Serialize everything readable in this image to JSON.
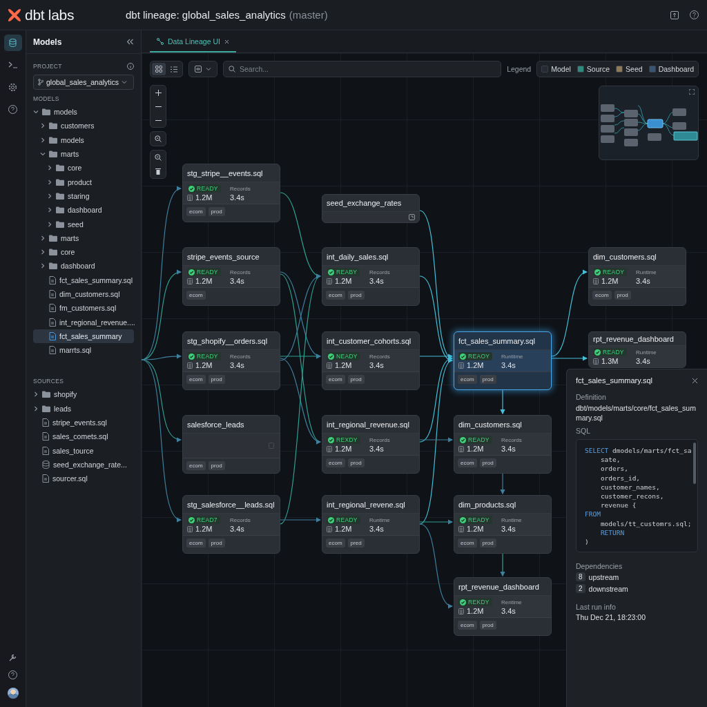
{
  "app": {
    "logo": "dbt labs",
    "title": "dbt lineage: global_sales_analytics",
    "branch": "(master)"
  },
  "sidebar": {
    "title": "Models",
    "project_label": "PROJECT",
    "project": "global_sales_analytics",
    "models_label": "MODELS",
    "sources_label": "SOURCES",
    "models": [
      {
        "label": "models",
        "kind": "folder",
        "expanded": true,
        "selected": false,
        "children": [
          {
            "label": "customers",
            "kind": "folder",
            "expanded": false,
            "selected": false
          },
          {
            "label": "models",
            "kind": "folder",
            "expanded": false,
            "selected": false
          },
          {
            "label": "marts",
            "kind": "folder",
            "expanded": true,
            "selected": false,
            "children": [
              {
                "label": "core",
                "kind": "folder",
                "expanded": false,
                "selected": false
              },
              {
                "label": "product",
                "kind": "folder",
                "expanded": false,
                "selected": false
              },
              {
                "label": "staring",
                "kind": "folder",
                "expanded": false,
                "selected": false
              },
              {
                "label": "dashboard",
                "kind": "folder",
                "expanded": false,
                "selected": false
              },
              {
                "label": "seed",
                "kind": "folder",
                "expanded": false,
                "selected": false
              }
            ]
          },
          {
            "label": "marts",
            "kind": "folder",
            "expanded": false,
            "selected": false
          },
          {
            "label": "core",
            "kind": "folder",
            "expanded": false,
            "selected": false
          },
          {
            "label": "dashboard",
            "kind": "folder",
            "expanded": false,
            "selected": false
          },
          {
            "label": "fct_sales_summary.sql",
            "kind": "file",
            "selected": false
          },
          {
            "label": "dim_customers.sql",
            "kind": "file",
            "selected": false
          },
          {
            "label": "fm_customers.sql",
            "kind": "file",
            "selected": false
          },
          {
            "label": "int_regional_revenue....",
            "kind": "file",
            "selected": false
          },
          {
            "label": "fct_sales_summary",
            "kind": "file",
            "selected": true
          },
          {
            "label": "marrts.sql",
            "kind": "file",
            "selected": false
          }
        ]
      }
    ],
    "sources": [
      {
        "label": "shopify",
        "kind": "folder",
        "expanded": false,
        "selected": false
      },
      {
        "label": "leads",
        "kind": "folder",
        "expanded": false,
        "selected": false
      },
      {
        "label": "stripe_events.sql",
        "kind": "file",
        "selected": false
      },
      {
        "label": "sales_comets.sql",
        "kind": "file",
        "selected": false
      },
      {
        "label": "sales_tource",
        "kind": "file",
        "selected": false
      },
      {
        "label": "seed_exchange_rate...",
        "kind": "seed",
        "selected": false
      },
      {
        "label": "sourcer.sql",
        "kind": "file",
        "selected": false
      }
    ]
  },
  "tabs": [
    {
      "label": "Data Lineage UI",
      "selected": true
    }
  ],
  "toolbar": {
    "views": [
      {
        "kind": "grid",
        "selected": true
      },
      {
        "kind": "list",
        "selected": false
      }
    ],
    "search_placeholder": "Search...",
    "legend_label": "Legend",
    "legend": [
      {
        "label": "Model",
        "color": "#262b33"
      },
      {
        "label": "Source",
        "color": "#2e8a7c"
      },
      {
        "label": "Seed",
        "color": "#8c7a58"
      },
      {
        "label": "Dashboard",
        "color": "#3a5573"
      }
    ]
  },
  "nodes": [
    {
      "title": "stg_stripe__events.sql",
      "kind": "metrics",
      "selected": false,
      "status": "READY",
      "metric": "Records",
      "count": "1.2M",
      "value": "3.4s",
      "tags": [
        "ecom",
        "prod"
      ]
    },
    {
      "title": "seed_exchange_rates",
      "kind": "collapsed",
      "selected": false
    },
    {
      "title": "stripe_events_source",
      "kind": "metrics",
      "selected": false,
      "status": "READY",
      "metric": "Records",
      "count": "1.2M",
      "value": "3.4s",
      "tags": [
        "ecom"
      ]
    },
    {
      "title": "int_daily_sales.sql",
      "kind": "metrics",
      "selected": false,
      "status": "REABY",
      "metric": "Records",
      "count": "1.2M",
      "value": "3.4s",
      "tags": [
        "ecom",
        "prod"
      ]
    },
    {
      "title": "dim_customers.sql",
      "kind": "metrics",
      "selected": false,
      "status": "REAOY",
      "metric": "Runtime",
      "count": "1.2M",
      "value": "3.4s",
      "tags": [
        "ecom",
        "prod"
      ]
    },
    {
      "title": "stg_shopify__orders.sql",
      "kind": "metrics",
      "selected": false,
      "status": "READY",
      "metric": "Records",
      "count": "1.2M",
      "value": "3.4s",
      "tags": [
        "ecom",
        "prod"
      ]
    },
    {
      "title": "int_customer_cohorts.sql",
      "kind": "metrics",
      "selected": false,
      "status": "NEADY",
      "metric": "Records",
      "count": "1.2M",
      "value": "3.4s",
      "tags": [
        "ecom",
        "prod"
      ]
    },
    {
      "title": "fct_sales_summary.sql",
      "kind": "metrics",
      "selected": true,
      "status": "REAOY",
      "metric": "Runtiime",
      "count": "1.2M",
      "value": "3.4s",
      "tags": [
        "ecom",
        "prod"
      ]
    },
    {
      "title": "rpt_revenue_dashboard",
      "kind": "metrics",
      "selected": false,
      "status": "READY",
      "metric": "Runtime",
      "count": "1.3M",
      "value": "3.4s"
    },
    {
      "title": "salesforce_leads",
      "kind": "blank",
      "selected": false,
      "tags": [
        "ecom",
        "prod"
      ]
    },
    {
      "title": "int_regional_revenue.sql",
      "kind": "metrics",
      "selected": false,
      "status": "REXDY",
      "metric": "Records",
      "count": "1.2M",
      "value": "3.4s",
      "tags": [
        "ecom",
        "prod"
      ]
    },
    {
      "title": "dim_customers.sql",
      "kind": "metrics",
      "selected": false,
      "status": "READY",
      "metric": "Records",
      "count": "1.2M",
      "value": "3.4s",
      "tags": [
        "ecom",
        "prod"
      ]
    },
    {
      "title": "stg_salesforce__leads.sql",
      "kind": "metrics",
      "selected": false,
      "status": "READ7",
      "metric": "Records",
      "count": "1.2M",
      "value": "3.4s",
      "tags": [
        "ecom",
        "prod"
      ]
    },
    {
      "title": "int_regional_revene.sql",
      "kind": "metrics",
      "selected": false,
      "status": "READY",
      "metric": "Runtime",
      "count": "1.2M",
      "value": "3.4s",
      "tags": [
        "ecom",
        "pred"
      ]
    },
    {
      "title": "dim_products.sql",
      "kind": "metrics",
      "selected": false,
      "status": "READY",
      "metric": "Runtime",
      "count": "1.2M",
      "value": "3.4s",
      "tags": [
        "ecom",
        "prod"
      ]
    },
    {
      "title": "rpt_revenue_dashboard",
      "kind": "metrics",
      "selected": false,
      "status": "REKDY",
      "metric": "Rentime",
      "count": "1.2M",
      "value": "3.4s",
      "tags": [
        "ecom",
        "prod"
      ]
    }
  ],
  "details": {
    "title": "fct_sales_summary.sql",
    "definition_label": "Definition",
    "definition": "dbt/models/marts/core/fct_sales_summary.sql",
    "sql_label": "SQL",
    "sql": [
      [
        {
          "text": "SELECT",
          "kind": "keyword"
        },
        {
          "text": " dmodels/marts/fct_sa",
          "kind": "plain"
        }
      ],
      [
        {
          "text": "    sate,",
          "kind": "plain"
        }
      ],
      [
        {
          "text": "    orders,",
          "kind": "plain"
        }
      ],
      [
        {
          "text": "    orders_id,",
          "kind": "plain"
        }
      ],
      [
        {
          "text": "    customer_names,",
          "kind": "plain"
        }
      ],
      [
        {
          "text": "    customer_recons,",
          "kind": "plain"
        }
      ],
      [
        {
          "text": "    revenue {",
          "kind": "plain"
        }
      ],
      [
        {
          "text": "FROM",
          "kind": "keyword"
        }
      ],
      [
        {
          "text": "    models/tt_customrs.sql;",
          "kind": "plain"
        }
      ],
      [
        {
          "text": "    RETURN",
          "kind": "keyword"
        }
      ],
      [
        {
          "text": ")",
          "kind": "plain"
        }
      ]
    ],
    "dependencies_label": "Dependencies",
    "dependencies": [
      {
        "count": "8",
        "label": "upstream"
      },
      {
        "count": "2",
        "label": "downstream"
      }
    ],
    "last_run_label": "Last run info",
    "last_run": "Thu Dec 21, 18:23:00"
  }
}
